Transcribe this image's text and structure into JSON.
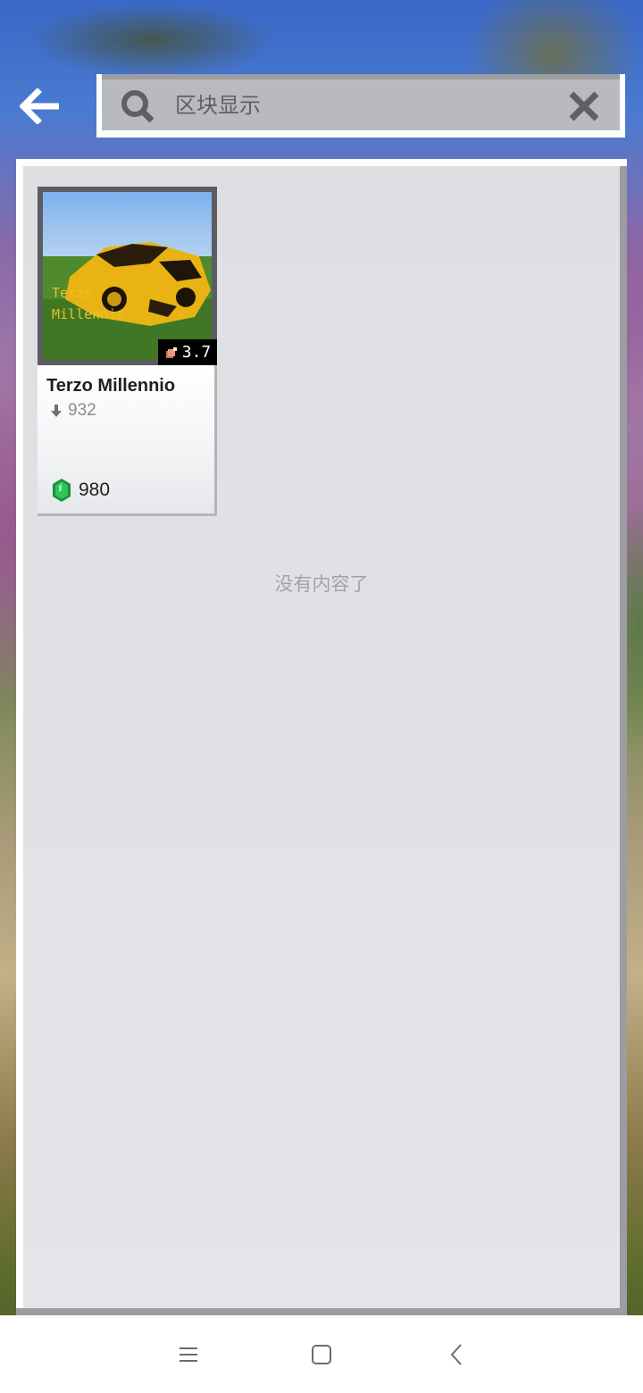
{
  "search": {
    "value": "",
    "placeholder": "区块显示"
  },
  "results": [
    {
      "title": "Terzo Millennio",
      "thumbnail_text_line1": "Terzo",
      "thumbnail_text_line2": "Millennio",
      "rating": "3.7",
      "downloads": "932",
      "price": "980"
    }
  ],
  "list_end_text": "没有内容了",
  "icons": {
    "back": "back-arrow-icon",
    "search": "search-icon",
    "clear": "close-icon",
    "rating": "meat-icon",
    "downloads": "download-arrow-icon",
    "currency": "emerald-icon",
    "nav_menu": "menu-icon",
    "nav_home": "home-square-icon",
    "nav_back": "chevron-left-icon"
  },
  "colors": {
    "panel_bg": "#e2e3e7",
    "search_bg": "#b9babd",
    "thumbnail_text": "#e8c12a",
    "emerald": "#1fae4a"
  }
}
